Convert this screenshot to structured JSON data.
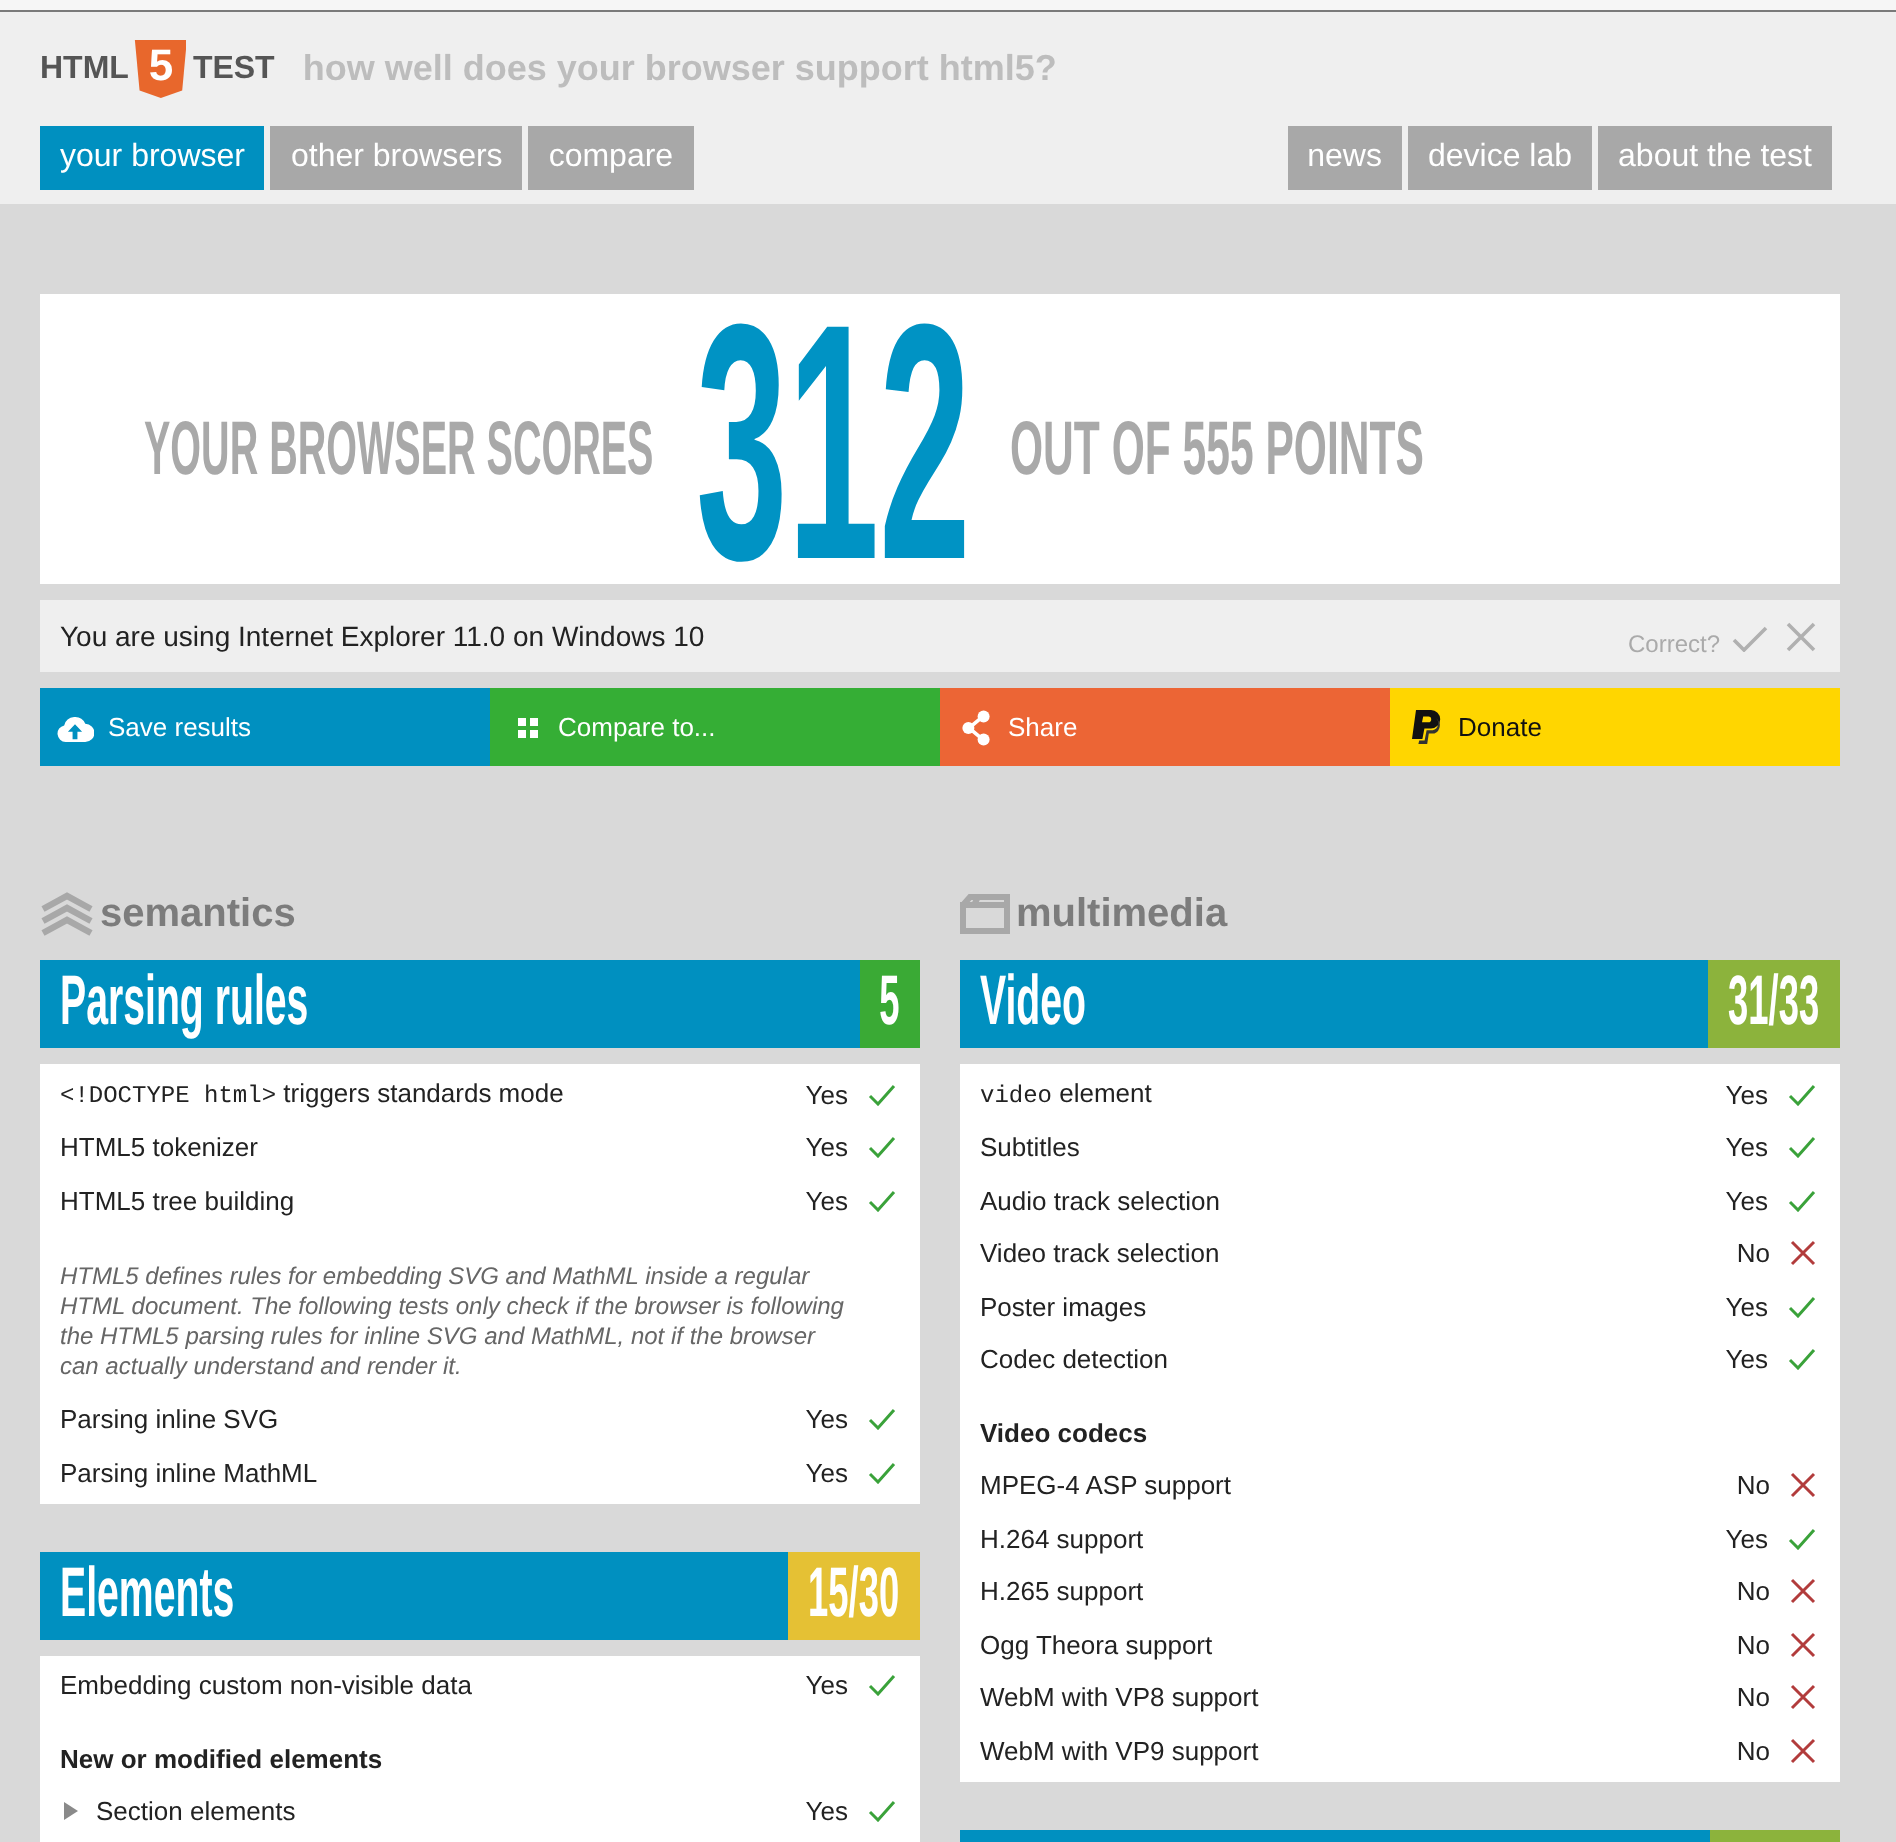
{
  "header": {
    "logo": {
      "left": "HTML",
      "badge": "5",
      "right": "TEST"
    },
    "tagline": "how well does your browser support html5?",
    "nav_left": [
      {
        "label": "your browser",
        "selected": true
      },
      {
        "label": "other browsers",
        "selected": false
      },
      {
        "label": "compare",
        "selected": false
      }
    ],
    "nav_right": [
      {
        "label": "news",
        "selected": false
      },
      {
        "label": "device lab",
        "selected": false
      },
      {
        "label": "about the test",
        "selected": false
      }
    ]
  },
  "score": {
    "lead": "YOUR BROWSER SCORES",
    "value": "312",
    "tail": "OUT OF 555 POINTS"
  },
  "detection": {
    "text": "You are using Internet Explorer 11.0 on Windows 10",
    "prompt": "Correct?"
  },
  "actions": [
    {
      "kind": "save",
      "label": "Save results",
      "color": "#0090c0"
    },
    {
      "kind": "compare",
      "label": "Compare to...",
      "color": "#35ae35"
    },
    {
      "kind": "share",
      "label": "Share",
      "color": "#ec6535"
    },
    {
      "kind": "donate",
      "label": "Donate",
      "color": "#ffd600"
    }
  ],
  "columns": [
    {
      "kind": "semantics",
      "category": "semantics",
      "sections": [
        {
          "title": "Parsing rules",
          "score": "5",
          "color": "#3aaa35",
          "rows": [
            {
              "kind": "test",
              "code": "<!DOCTYPE html>",
              "name": "triggers standards mode",
              "result": "Yes",
              "passed": true
            },
            {
              "kind": "test",
              "name": "HTML5 tokenizer",
              "result": "Yes",
              "passed": true
            },
            {
              "kind": "test",
              "name": "HTML5 tree building",
              "result": "Yes",
              "passed": true
            },
            {
              "kind": "note",
              "text": "HTML5 defines rules for embedding SVG and MathML inside a regular HTML document. The following tests only check if the browser is following the HTML5 parsing rules for inline SVG and MathML, not if the browser can actually understand and render it."
            },
            {
              "kind": "test",
              "name": "Parsing inline SVG",
              "result": "Yes",
              "passed": true
            },
            {
              "kind": "test",
              "name": "Parsing inline MathML",
              "result": "Yes",
              "passed": true
            }
          ]
        },
        {
          "title": "Elements",
          "score": "15/30",
          "color": "#e5c134",
          "rows": [
            {
              "kind": "test",
              "name": "Embedding custom non-visible data",
              "result": "Yes",
              "passed": true
            },
            {
              "kind": "heading",
              "text": "New or modified elements"
            },
            {
              "kind": "group",
              "name": "Section elements",
              "result": "Yes",
              "passed": true,
              "expanded": false
            }
          ]
        }
      ]
    },
    {
      "kind": "multimedia",
      "category": "multimedia",
      "sections": [
        {
          "title": "Video",
          "score": "31/33",
          "color": "#8cb33c",
          "rows": [
            {
              "kind": "test",
              "code": "video",
              "name": "element",
              "result": "Yes",
              "passed": true
            },
            {
              "kind": "test",
              "name": "Subtitles",
              "result": "Yes",
              "passed": true
            },
            {
              "kind": "test",
              "name": "Audio track selection",
              "result": "Yes",
              "passed": true
            },
            {
              "kind": "test",
              "name": "Video track selection",
              "result": "No",
              "passed": false
            },
            {
              "kind": "test",
              "name": "Poster images",
              "result": "Yes",
              "passed": true
            },
            {
              "kind": "test",
              "name": "Codec detection",
              "result": "Yes",
              "passed": true
            },
            {
              "kind": "heading",
              "text": "Video codecs"
            },
            {
              "kind": "test",
              "name": "MPEG-4 ASP support",
              "result": "No",
              "passed": false
            },
            {
              "kind": "test",
              "name": "H.264 support",
              "result": "Yes",
              "passed": true
            },
            {
              "kind": "test",
              "name": "H.265 support",
              "result": "No",
              "passed": false
            },
            {
              "kind": "test",
              "name": "Ogg Theora support",
              "result": "No",
              "passed": false
            },
            {
              "kind": "test",
              "name": "WebM with VP8 support",
              "result": "No",
              "passed": false
            },
            {
              "kind": "test",
              "name": "WebM with VP9 support",
              "result": "No",
              "passed": false
            }
          ]
        },
        {
          "color": "#8cb33c"
        }
      ]
    }
  ]
}
